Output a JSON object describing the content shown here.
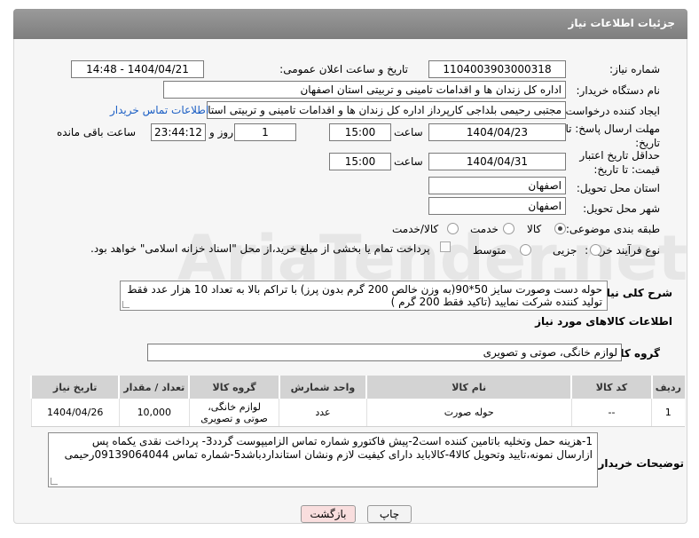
{
  "header": {
    "title": "جزئیات اطلاعات نیاز"
  },
  "fields": {
    "need_number_label": "شماره نیاز:",
    "need_number": "1104003903000318",
    "announce_label": "تاریخ و ساعت اعلان عمومی:",
    "announce_value": "1404/04/21 - 14:48",
    "buyer_org_label": "نام دستگاه خریدار:",
    "buyer_org": "اداره کل زندان ها و اقدامات تامینی و تربیتی استان اصفهان",
    "creator_label": "ایجاد کننده درخواست:",
    "creator": "مجتبی رحیمی بلداجی کارپرداز اداره کل زندان ها و اقدامات تامینی و تربیتی استان اصفهان",
    "contact_link": "اطلاعات تماس خریدار",
    "reply_deadline_label": "مهلت ارسال پاسخ: تا تاریخ:",
    "reply_date": "1404/04/23",
    "time_label": "ساعت",
    "reply_time": "15:00",
    "days_value": "1",
    "days_label": "روز و",
    "remaining_time": "23:44:12",
    "remaining_label": "ساعت باقی مانده",
    "price_validity_label": "حداقل تاریخ اعتبار قیمت: تا تاریخ:",
    "price_date": "1404/04/31",
    "price_time": "15:00",
    "province_label": "استان محل تحویل:",
    "province": "اصفهان",
    "city_label": "شهر محل تحویل:",
    "city": "اصفهان",
    "category_label": "طبقه بندی موضوعی:",
    "category_options": [
      "کالا",
      "خدمت",
      "کالا/خدمت"
    ],
    "purchase_type_label": "نوع فرآیند خرید :",
    "purchase_options": [
      "جزیی",
      "متوسط"
    ],
    "purchase_note": "پرداخت تمام یا بخشی از مبلغ خرید،از محل \"اسناد خزانه اسلامی\" خواهد بود."
  },
  "description": {
    "label": "شرح کلی نیاز:",
    "text": "حوله دست وصورت سایز 50*90(به وزن خالص 200 گرم بدون پرز) با تراکم بالا به تعداد 10 هزار عدد فقط تولید کننده شرکت نمایید  (تاکید فقط 200 گرم )"
  },
  "goods": {
    "section_title": "اطلاعات کالاهای مورد نیاز",
    "group_label": "گروه کالا:",
    "group_value": "لوازم خانگی، صوتی و تصویری",
    "columns": [
      "ردیف",
      "کد کالا",
      "نام کالا",
      "واحد شمارش",
      "گروه کالا",
      "تعداد / مقدار",
      "تاریخ نیاز"
    ],
    "rows": [
      {
        "row": "1",
        "code": "--",
        "name": "حوله صورت",
        "unit": "عدد",
        "group_line1": "لوازم خانگی،",
        "group_line2": "صوتی و تصویری",
        "qty": "10,000",
        "date": "1404/04/26"
      }
    ]
  },
  "buyer_notes": {
    "label": "توضیحات خریدار:",
    "text": "1-هزینه حمل وتخلیه باتامین کننده است2-پیش فاکتورو شماره تماس الزامیپوست گردد3- پرداخت نقدی یکماه  پس ازارسال نمونه،تایید وتحویل کالا4-کالاباید دارای کیفیت لازم ونشان استانداردباشد5-شماره تماس 09139064044رحیمی"
  },
  "buttons": {
    "print": "چاپ",
    "back": "بازگشت"
  },
  "colors": {
    "header_bg": "#8a8a8a",
    "link": "#1b5ec4",
    "back_button": "#f9dede"
  }
}
